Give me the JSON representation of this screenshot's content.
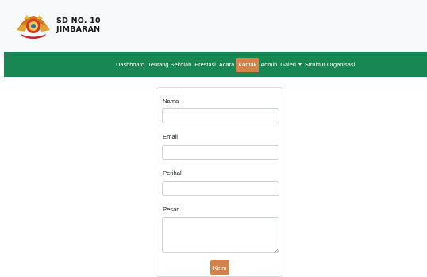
{
  "brand": {
    "line1": "SD NO. 10",
    "line2": "JIMBARAN",
    "logo_icon": "school-emblem-icon"
  },
  "colors": {
    "navbar": "#198754",
    "accent": "#d2834a",
    "header_bg": "#f8f9fa"
  },
  "nav": {
    "items": [
      {
        "label": "Dashboard"
      },
      {
        "label": "Tentang Sekolah"
      },
      {
        "label": "Prestasi"
      },
      {
        "label": "Acara"
      },
      {
        "label": "Kontak"
      },
      {
        "label": "Admin"
      },
      {
        "label": "Galeri"
      },
      {
        "label": "Struktur Organisasi"
      }
    ],
    "active": "Kontak"
  },
  "form": {
    "nama_label": "Nama",
    "nama_value": "",
    "email_label": "Email",
    "email_value": "",
    "perihal_label": "Perihal",
    "perihal_value": "",
    "pesan_label": "Pesan",
    "pesan_value": "",
    "submit_label": "Kirim"
  }
}
